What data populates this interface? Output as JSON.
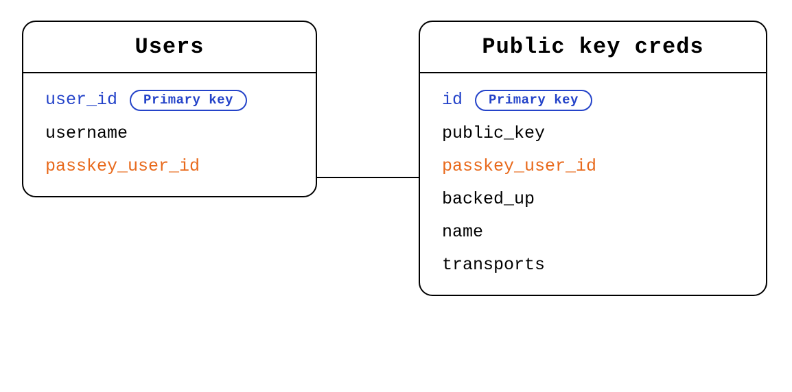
{
  "entities": {
    "users": {
      "title": "Users",
      "fields": [
        {
          "name": "user_id",
          "pk": true
        },
        {
          "name": "username"
        },
        {
          "name": "passkey_user_id",
          "fk": true
        }
      ]
    },
    "creds": {
      "title": "Public key creds",
      "fields": [
        {
          "name": "id",
          "pk": true
        },
        {
          "name": "public_key"
        },
        {
          "name": "passkey_user_id",
          "fk": true
        },
        {
          "name": "backed_up"
        },
        {
          "name": "name"
        },
        {
          "name": "transports"
        }
      ]
    }
  },
  "labels": {
    "primary_key": "Primary key"
  },
  "colors": {
    "primary": "#2443c9",
    "foreign": "#e8691b",
    "text": "#000000",
    "border": "#000000"
  }
}
